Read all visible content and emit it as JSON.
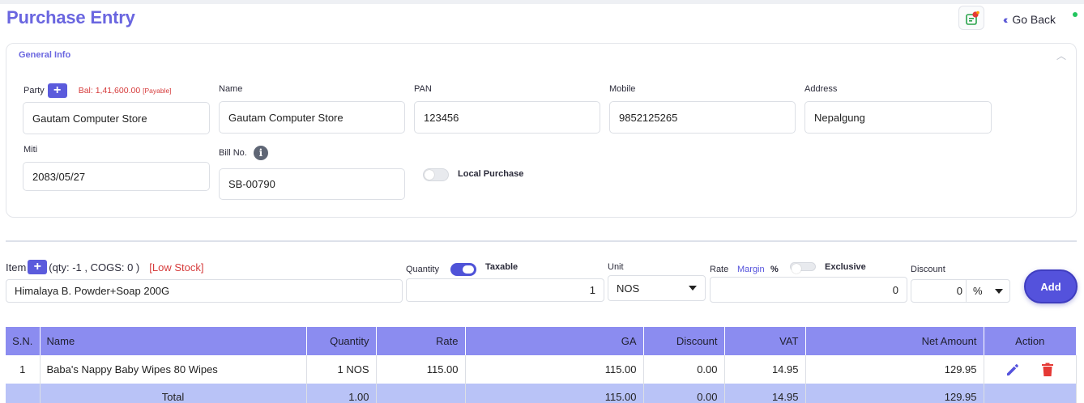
{
  "header": {
    "title": "Purchase Entry",
    "go_back_label": "Go Back",
    "go_back_icon": "double-chevron-left-icon"
  },
  "general_info": {
    "title": "General Info",
    "party": {
      "label": "Party",
      "balance": "Bal: 1,41,600.00",
      "balance_status": "[Payable]",
      "value": "Gautam Computer Store"
    },
    "name": {
      "label": "Name",
      "value": "Gautam Computer Store"
    },
    "pan": {
      "label": "PAN",
      "value": "123456"
    },
    "mobile": {
      "label": "Mobile",
      "value": "9852125265"
    },
    "address": {
      "label": "Address",
      "value": "Nepalgung"
    },
    "miti": {
      "label": "Miti",
      "value": "2083/05/27"
    },
    "bill_no": {
      "label": "Bill No.",
      "value": "SB-00790"
    },
    "local_purchase": {
      "label": "Local Purchase",
      "enabled": false
    }
  },
  "item_entry": {
    "item_label": "Item",
    "item_meta": "(qty: -1 , COGS: 0 )",
    "stock_status": "[Low Stock]",
    "item_value": "Himalaya B. Powder+Soap 200G",
    "quantity_label": "Quantity",
    "taxable_label": "Taxable",
    "taxable_enabled": true,
    "quantity_value": "1",
    "unit_label": "Unit",
    "unit_value": "NOS",
    "rate_label": "Rate",
    "margin_label": "Margin",
    "percent_sign": "%",
    "exclusive_label": "Exclusive",
    "exclusive_enabled": false,
    "rate_value": "0",
    "discount_label": "Discount",
    "discount_value": "0",
    "discount_type": "%",
    "add_label": "Add"
  },
  "table": {
    "columns": [
      "S.N.",
      "Name",
      "Quantity",
      "Rate",
      "GA",
      "Discount",
      "VAT",
      "Net Amount",
      "Action"
    ],
    "rows": [
      {
        "sn": "1",
        "name": "Baba's Nappy Baby Wipes 80 Wipes",
        "quantity": "1 NOS",
        "rate": "115.00",
        "ga": "115.00",
        "discount": "0.00",
        "vat": "14.95",
        "net_amount": "129.95"
      }
    ],
    "total": {
      "label": "Total",
      "quantity": "1.00",
      "ga": "115.00",
      "discount": "0.00",
      "vat": "14.95",
      "net_amount": "129.95"
    }
  },
  "colors": {
    "accent": "#5452dc",
    "title": "#6a66e0",
    "danger": "#d63b3b",
    "table_header": "#8b8cf0",
    "total_row": "#b9c3f7"
  }
}
